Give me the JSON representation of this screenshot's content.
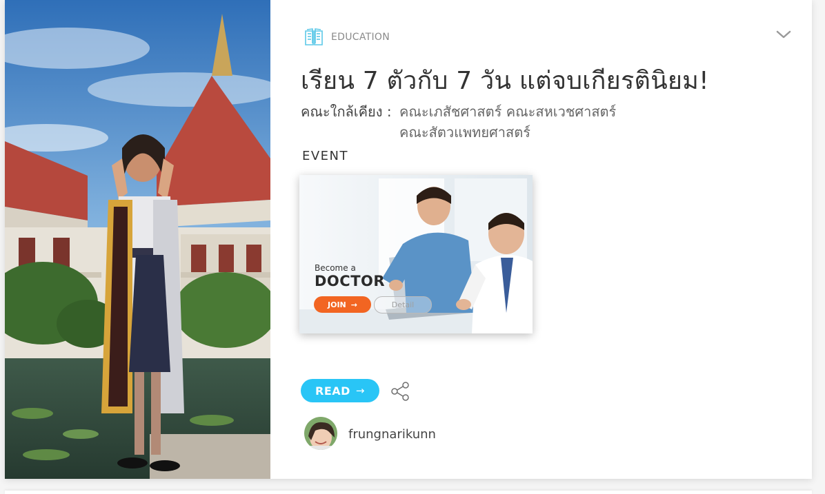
{
  "category": {
    "label": "EDUCATION",
    "icon": "open-book-icon"
  },
  "title": "เรียน 7 ตัวกับ 7 วัน แต่จบเกียรตินิยม!",
  "faculty": {
    "label": "คณะใกล้เคียง :",
    "line1": "คณะเภสัชศาสตร์ คณะสหเวชศาสตร์",
    "line2": "คณะสัตวแพทยศาสตร์"
  },
  "event": {
    "label": "EVENT",
    "banner": {
      "tagline": "Become a",
      "headline": "DOCTOR",
      "join_label": "JOIN",
      "detail_label": "Detail"
    }
  },
  "actions": {
    "read_label": "READ"
  },
  "author": {
    "username": "frungnarikunn"
  },
  "colors": {
    "accent": "#29c5f6",
    "join": "#f26522",
    "icon": "#5bc8e8"
  }
}
